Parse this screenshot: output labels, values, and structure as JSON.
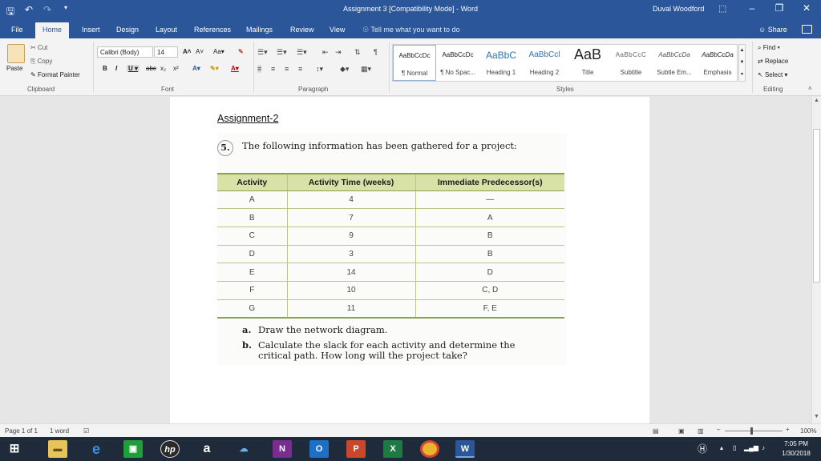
{
  "window": {
    "title": "Assignment 3 [Compatibility Mode]  -  Word",
    "user": "Duval Woodford"
  },
  "tabs": [
    "File",
    "Home",
    "Insert",
    "Design",
    "Layout",
    "References",
    "Mailings",
    "Review",
    "View"
  ],
  "active_tab": "Home",
  "tell_me": "Tell me what you want to do",
  "share": "Share",
  "clipboard": {
    "paste": "Paste",
    "cut": "Cut",
    "copy": "Copy",
    "format_painter": "Format Painter",
    "label": "Clipboard"
  },
  "font": {
    "name": "Calibri (Body)",
    "size": "14",
    "label": "Font"
  },
  "paragraph": {
    "label": "Paragraph"
  },
  "styles": {
    "label": "Styles",
    "items": [
      {
        "sample": "AaBbCcDc",
        "name": "¶ Normal"
      },
      {
        "sample": "AaBbCcDc",
        "name": "¶ No Spac..."
      },
      {
        "sample": "AaBbC",
        "name": "Heading 1"
      },
      {
        "sample": "AaBbCcl",
        "name": "Heading 2"
      },
      {
        "sample": "AaB",
        "name": "Title"
      },
      {
        "sample": "AaBbCcC",
        "name": "Subtitle"
      },
      {
        "sample": "AaBbCcDa",
        "name": "Subtle Em..."
      },
      {
        "sample": "AaBbCcDa",
        "name": "Emphasis"
      }
    ]
  },
  "editing": {
    "find": "Find",
    "replace": "Replace",
    "select": "Select",
    "label": "Editing"
  },
  "document": {
    "heading": "Assignment-2",
    "question_number": "5.",
    "question_text": "The following information has been gathered for a project:",
    "table": {
      "headers": [
        "Activity",
        "Activity Time (weeks)",
        "Immediate Predecessor(s)"
      ],
      "rows": [
        [
          "A",
          "4",
          "—"
        ],
        [
          "B",
          "7",
          "A"
        ],
        [
          "C",
          "9",
          "B"
        ],
        [
          "D",
          "3",
          "B"
        ],
        [
          "E",
          "14",
          "D"
        ],
        [
          "F",
          "10",
          "C, D"
        ],
        [
          "G",
          "11",
          "F, E"
        ]
      ]
    },
    "part_a_label": "a.",
    "part_a_text": "Draw the network diagram.",
    "part_b_label": "b.",
    "part_b_line1": "Calculate the slack for each activity and determine the",
    "part_b_line2": "critical path. How long will the project take?"
  },
  "statusbar": {
    "page": "Page 1 of 1",
    "words": "1 word",
    "zoom": "100%"
  },
  "taskbar": {
    "time": "7:05 PM",
    "date": "1/30/2018"
  }
}
